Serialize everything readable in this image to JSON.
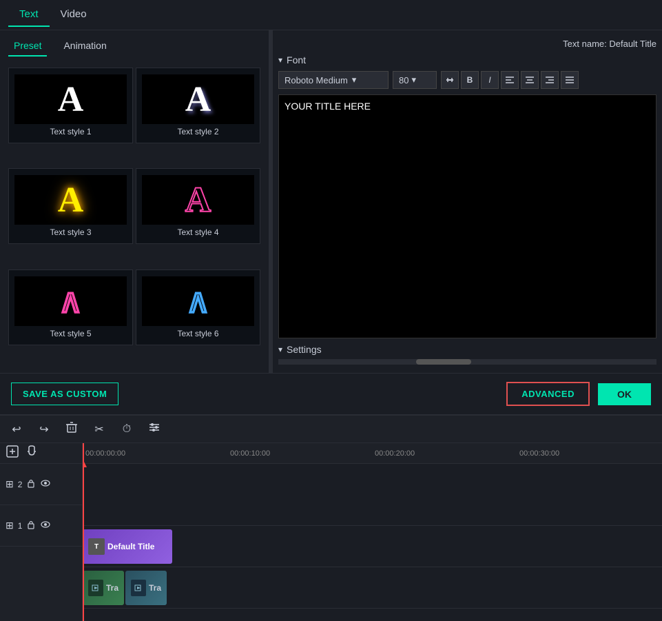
{
  "topTabs": [
    {
      "id": "text",
      "label": "Text",
      "active": true
    },
    {
      "id": "video",
      "label": "Video",
      "active": false
    }
  ],
  "subTabs": [
    {
      "id": "preset",
      "label": "Preset",
      "active": true
    },
    {
      "id": "animation",
      "label": "Animation",
      "active": false
    }
  ],
  "textNameLabel": "Text name: Default Title",
  "textStyles": [
    {
      "id": "style1",
      "label": "Text style 1"
    },
    {
      "id": "style2",
      "label": "Text style 2"
    },
    {
      "id": "style3",
      "label": "Text style 3"
    },
    {
      "id": "style4",
      "label": "Text style 4"
    },
    {
      "id": "style5",
      "label": "Text style 5"
    },
    {
      "id": "style6",
      "label": "Text style 6"
    }
  ],
  "fontSection": {
    "headerLabel": "Font",
    "fontName": "Roboto Medium",
    "fontSize": "80",
    "textContent": "YOUR TITLE HERE"
  },
  "settingsSection": {
    "headerLabel": "Settings"
  },
  "buttons": {
    "saveAsCustom": "SAVE AS CUSTOM",
    "advanced": "ADVANCED",
    "ok": "OK"
  },
  "timeline": {
    "timeMarkers": [
      "00:00:00:00",
      "00:00:10:00",
      "00:00:20:00",
      "00:00:30:00"
    ],
    "tracks": [
      {
        "id": "track2",
        "number": "2",
        "clips": [
          {
            "label": "Default Title",
            "type": "text",
            "color": "purple"
          }
        ]
      },
      {
        "id": "track1",
        "number": "1",
        "clips": [
          {
            "label": "Tra",
            "type": "video"
          },
          {
            "label": "Tra",
            "type": "video2"
          }
        ]
      }
    ]
  }
}
